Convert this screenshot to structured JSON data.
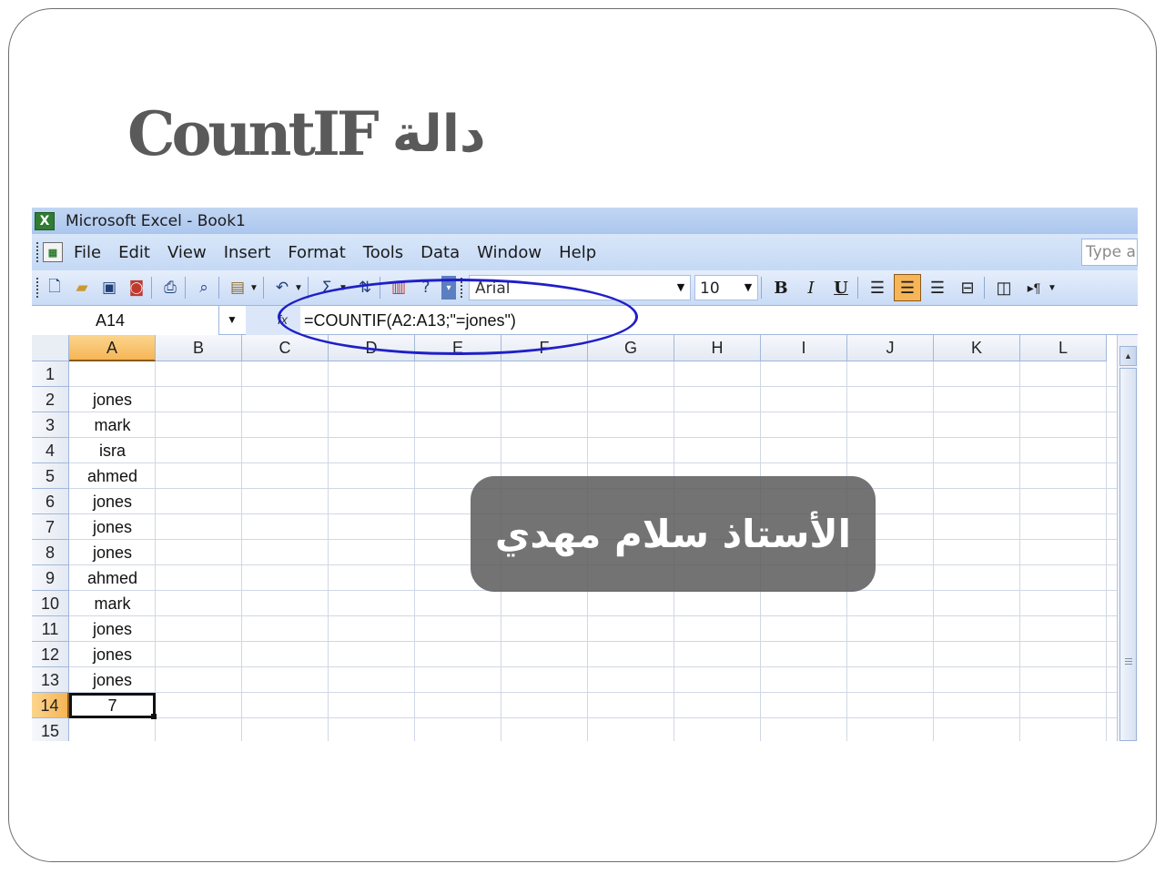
{
  "slide": {
    "title_en": "CountIF",
    "title_ar": "دالة"
  },
  "window": {
    "title": "Microsoft Excel - Book1",
    "app_icon": "X"
  },
  "menu": {
    "items": [
      "File",
      "Edit",
      "View",
      "Insert",
      "Format",
      "Tools",
      "Data",
      "Window",
      "Help"
    ],
    "ask_placeholder": "Type a"
  },
  "toolbar": {
    "icons": [
      "new-icon",
      "open-icon",
      "save-icon",
      "permission-icon",
      "print-icon",
      "print-preview-icon",
      "paste-icon",
      "undo-icon",
      "autosum-icon",
      "sort-icon",
      "chart-icon",
      "help-icon"
    ],
    "autosum_symbol": "Σ",
    "font_name": "Arial",
    "font_size": "10",
    "bold_label": "B",
    "italic_label": "I",
    "underline_label": "U"
  },
  "formula_bar": {
    "name_box": "A14",
    "fx": "fx",
    "formula": "=COUNTIF(A2:A13;\"=jones\")"
  },
  "grid": {
    "columns": [
      "A",
      "B",
      "C",
      "D",
      "E",
      "F",
      "G",
      "H",
      "I",
      "J",
      "K",
      "L"
    ],
    "selected_column": "A",
    "selected_row": "14",
    "rows": [
      {
        "num": "1",
        "a": ""
      },
      {
        "num": "2",
        "a": "jones"
      },
      {
        "num": "3",
        "a": "mark"
      },
      {
        "num": "4",
        "a": "isra"
      },
      {
        "num": "5",
        "a": "ahmed"
      },
      {
        "num": "6",
        "a": "jones"
      },
      {
        "num": "7",
        "a": "jones"
      },
      {
        "num": "8",
        "a": "jones"
      },
      {
        "num": "9",
        "a": "ahmed"
      },
      {
        "num": "10",
        "a": "mark"
      },
      {
        "num": "11",
        "a": "jones"
      },
      {
        "num": "12",
        "a": "jones"
      },
      {
        "num": "13",
        "a": "jones"
      },
      {
        "num": "14",
        "a": "7"
      },
      {
        "num": "15",
        "a": ""
      }
    ]
  },
  "watermark": {
    "text": "الأستاذ سلام مهدي"
  },
  "colors": {
    "selection_accent": "#f6b556",
    "oval": "#1f1fc7",
    "title_gray": "#5a5a5a"
  }
}
